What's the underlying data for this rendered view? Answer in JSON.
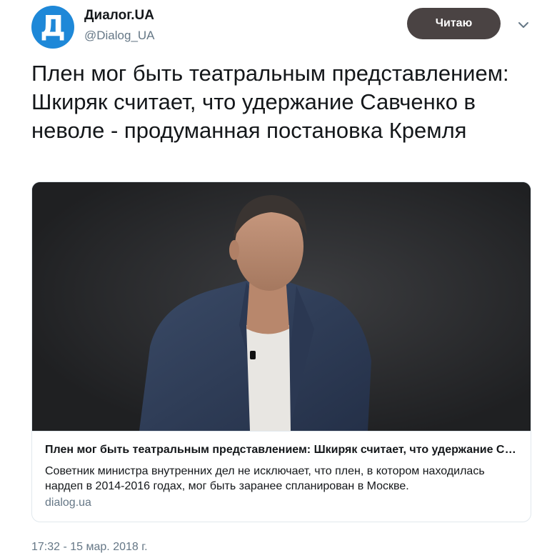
{
  "author": {
    "display_name": "Диалог.UA",
    "handle": "@Dialog_UA",
    "avatar_letter": "Д",
    "avatar_color": "#1e88d8"
  },
  "follow_button": {
    "label": "Читаю",
    "background": "#4a4343"
  },
  "menu_icon": "chevron-down-icon",
  "tweet": {
    "text": "Плен мог быть театральным представлением: Шкиряк считает, что удержание Савченко в неволе - продуманная постановка Кремля"
  },
  "card": {
    "title": "Плен мог быть театральным представлением: Шкиряк считает, что удержание Савченко в неволе - продуманная постановка Кремля",
    "description": "Советник министра внутренних дел не исключает, что плен, в котором находилась нардеп в 2014-2016 годах, мог быть заранее спланирован в Москве.",
    "domain": "dialog.ua"
  },
  "timestamp": "17:32 - 15 мар. 2018 г.",
  "colors": {
    "text": "#14171a",
    "secondary_text": "#657786",
    "border": "#e1e8ed"
  }
}
